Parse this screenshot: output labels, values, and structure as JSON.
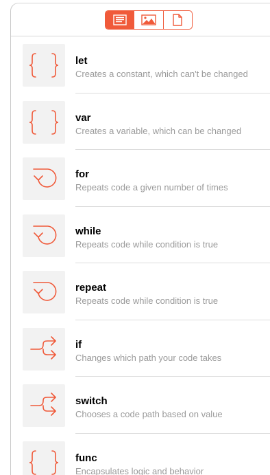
{
  "toolbar": {
    "segments": [
      {
        "icon": "text-lines-icon",
        "active": true
      },
      {
        "icon": "image-icon",
        "active": false
      },
      {
        "icon": "document-icon",
        "active": false
      }
    ]
  },
  "accent_color": "#f05a3a",
  "items": [
    {
      "name": "let",
      "desc": "Creates a constant, which can't be changed",
      "icon": "braces-icon"
    },
    {
      "name": "var",
      "desc": "Creates a variable, which can be changed",
      "icon": "braces-icon"
    },
    {
      "name": "for",
      "desc": "Repeats code a given number of times",
      "icon": "loop-arrow-icon"
    },
    {
      "name": "while",
      "desc": "Repeats code while condition is true",
      "icon": "loop-arrow-icon"
    },
    {
      "name": "repeat",
      "desc": "Repeats code while condition is true",
      "icon": "loop-arrow-icon"
    },
    {
      "name": "if",
      "desc": "Changes which path your code takes",
      "icon": "branch-arrow-icon"
    },
    {
      "name": "switch",
      "desc": "Chooses a code path based on value",
      "icon": "branch-arrow-icon"
    },
    {
      "name": "func",
      "desc": "Encapsulates logic and behavior",
      "icon": "braces-icon"
    }
  ]
}
